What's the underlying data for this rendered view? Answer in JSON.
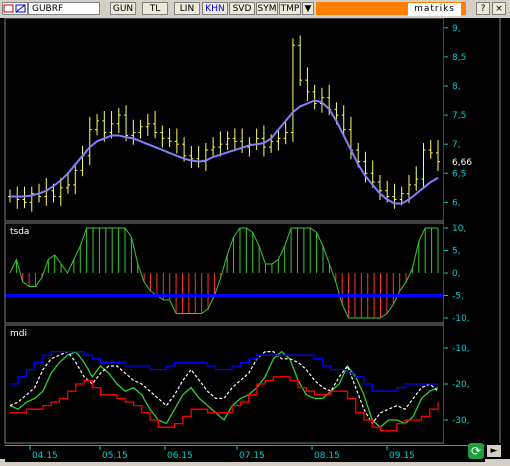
{
  "toolbar": {
    "symbol": "GUBRF",
    "buttons": [
      "GUN",
      "TL",
      "LIN",
      "KHN",
      "SVD",
      "SYM",
      "TMP"
    ],
    "active_button": "KHN",
    "brand": "matriks",
    "window_controls": [
      "?",
      "×"
    ]
  },
  "colors": {
    "price": "#ffff66",
    "ma": "#8080ff",
    "tsda_positive": "#33cc33",
    "tsda_negative": "#ff3333",
    "tsda_zero": "#0000ff",
    "mdi_green": "#33cc33",
    "mdi_red": "#ff0000",
    "mdi_blue": "#0000ff",
    "mdi_white": "#ffffff",
    "axis": "#00cccc"
  },
  "chart_data": [
    {
      "type": "candlestick",
      "name": "price",
      "title": "",
      "ylim": [
        5.8,
        9.1
      ],
      "yticks": [
        "9,",
        "8,5",
        "8,",
        "7,5",
        "7,",
        "6,5",
        "6,"
      ],
      "last_value": "6,66",
      "x_labels": [
        "04.15",
        "05.15",
        "06.15",
        "07.15",
        "08.15",
        "09.15"
      ],
      "close": [
        6.1,
        6.05,
        6.0,
        6.15,
        6.1,
        6.2,
        6.1,
        6.25,
        6.3,
        6.55,
        6.8,
        7.25,
        7.4,
        7.2,
        7.35,
        7.5,
        7.15,
        7.2,
        7.3,
        7.35,
        7.2,
        7.1,
        7.05,
        7.0,
        6.8,
        6.75,
        6.7,
        6.9,
        6.95,
        7.0,
        7.1,
        7.05,
        6.95,
        7.0,
        7.1,
        6.95,
        7.05,
        7.1,
        7.2,
        8.7,
        8.1,
        7.9,
        7.7,
        7.8,
        7.6,
        7.5,
        7.25,
        6.9,
        6.7,
        6.5,
        6.35,
        6.2,
        6.1,
        6.05,
        6.15,
        6.3,
        6.4,
        6.9,
        6.85,
        6.7
      ],
      "ma": [
        6.1,
        6.1,
        6.1,
        6.12,
        6.15,
        6.2,
        6.28,
        6.38,
        6.5,
        6.65,
        6.8,
        6.95,
        7.05,
        7.1,
        7.15,
        7.15,
        7.12,
        7.1,
        7.05,
        7.0,
        6.95,
        6.9,
        6.85,
        6.8,
        6.75,
        6.72,
        6.7,
        6.72,
        6.78,
        6.82,
        6.86,
        6.9,
        6.94,
        6.98,
        7.0,
        7.02,
        7.1,
        7.25,
        7.4,
        7.55,
        7.65,
        7.7,
        7.75,
        7.72,
        7.6,
        7.4,
        7.15,
        6.9,
        6.65,
        6.45,
        6.3,
        6.15,
        6.05,
        5.98,
        5.98,
        6.05,
        6.15,
        6.25,
        6.35,
        6.42
      ]
    },
    {
      "type": "histogram",
      "name": "tsda",
      "title": "tsda",
      "ylim": [
        -10,
        10
      ],
      "yticks": [
        "10,",
        "5,",
        "0,",
        "-5,",
        "-10,"
      ],
      "values": [
        0,
        3,
        -2,
        -3,
        -3,
        -1,
        3,
        4,
        2,
        0,
        3,
        6,
        10,
        10,
        10,
        10,
        10,
        10,
        10,
        8,
        2,
        -2,
        -4,
        -5,
        -6,
        -6,
        -9,
        -9,
        -9,
        -9,
        -9,
        -8,
        -5,
        -1,
        4,
        8,
        10,
        10,
        9,
        6,
        2,
        2,
        3,
        6,
        10,
        10,
        10,
        10,
        9,
        6,
        2,
        -2,
        -7,
        -10,
        -10,
        -10,
        -10,
        -10,
        -10,
        -9,
        -7,
        -4,
        -2,
        1,
        7,
        10,
        10,
        10
      ],
      "signal": -5
    },
    {
      "type": "line",
      "name": "mdi",
      "title": "mdi",
      "ylim": [
        -35,
        -5
      ],
      "yticks": [
        "-10,",
        "-20,",
        "-30,"
      ],
      "series": [
        {
          "name": "",
          "values": [
            -26,
            -27,
            -25,
            -24,
            -22,
            -17,
            -14,
            -12,
            -11,
            -14,
            -18,
            -15,
            -17,
            -20,
            -22,
            -21,
            -23,
            -27,
            -30,
            -31,
            -27,
            -23,
            -21,
            -24,
            -26,
            -28,
            -30,
            -26,
            -24,
            -23,
            -21,
            -18,
            -13,
            -11,
            -13,
            -19,
            -23,
            -24,
            -24,
            -22,
            -20,
            -15,
            -18,
            -23,
            -30,
            -32,
            -30,
            -30,
            -31,
            -29,
            -24,
            -22,
            -21
          ]
        },
        {
          "name": "",
          "values": [
            -26,
            -25,
            -23,
            -21,
            -16,
            -13,
            -12,
            -11,
            -14,
            -18,
            -20,
            -17,
            -15,
            -15,
            -17,
            -19,
            -20,
            -22,
            -24,
            -26,
            -23,
            -19,
            -16,
            -19,
            -22,
            -24,
            -24,
            -21,
            -19,
            -17,
            -13,
            -11,
            -11,
            -13,
            -13,
            -14,
            -16,
            -19,
            -21,
            -22,
            -18,
            -15,
            -21,
            -27,
            -31,
            -28,
            -27,
            -26,
            -27,
            -24,
            -21,
            -20,
            -22
          ]
        },
        {
          "name": "",
          "values": [
            -28,
            -28,
            -27,
            -27,
            -26,
            -25,
            -24,
            -22,
            -20,
            -19,
            -21,
            -23,
            -23,
            -24,
            -25,
            -26,
            -28,
            -30,
            -32,
            -32,
            -31,
            -29,
            -27,
            -27,
            -28,
            -28,
            -28,
            -26,
            -25,
            -23,
            -20,
            -19,
            -18,
            -18,
            -19,
            -21,
            -22,
            -23,
            -23,
            -22,
            -22,
            -24,
            -28,
            -30,
            -32,
            -33,
            -33,
            -31,
            -30,
            -30,
            -29,
            -27,
            -25
          ]
        },
        {
          "name": "",
          "values": [
            -20,
            -18,
            -16,
            -14,
            -12,
            -11,
            -11,
            -11,
            -11,
            -12,
            -13,
            -14,
            -14,
            -14,
            -15,
            -15,
            -15,
            -16,
            -16,
            -15,
            -14,
            -14,
            -14,
            -14,
            -15,
            -16,
            -16,
            -15,
            -14,
            -13,
            -12,
            -12,
            -12,
            -12,
            -12,
            -12,
            -12,
            -13,
            -15,
            -16,
            -16,
            -17,
            -18,
            -20,
            -22,
            -22,
            -22,
            -21,
            -20,
            -20,
            -20,
            -20,
            -20
          ]
        }
      ]
    }
  ]
}
